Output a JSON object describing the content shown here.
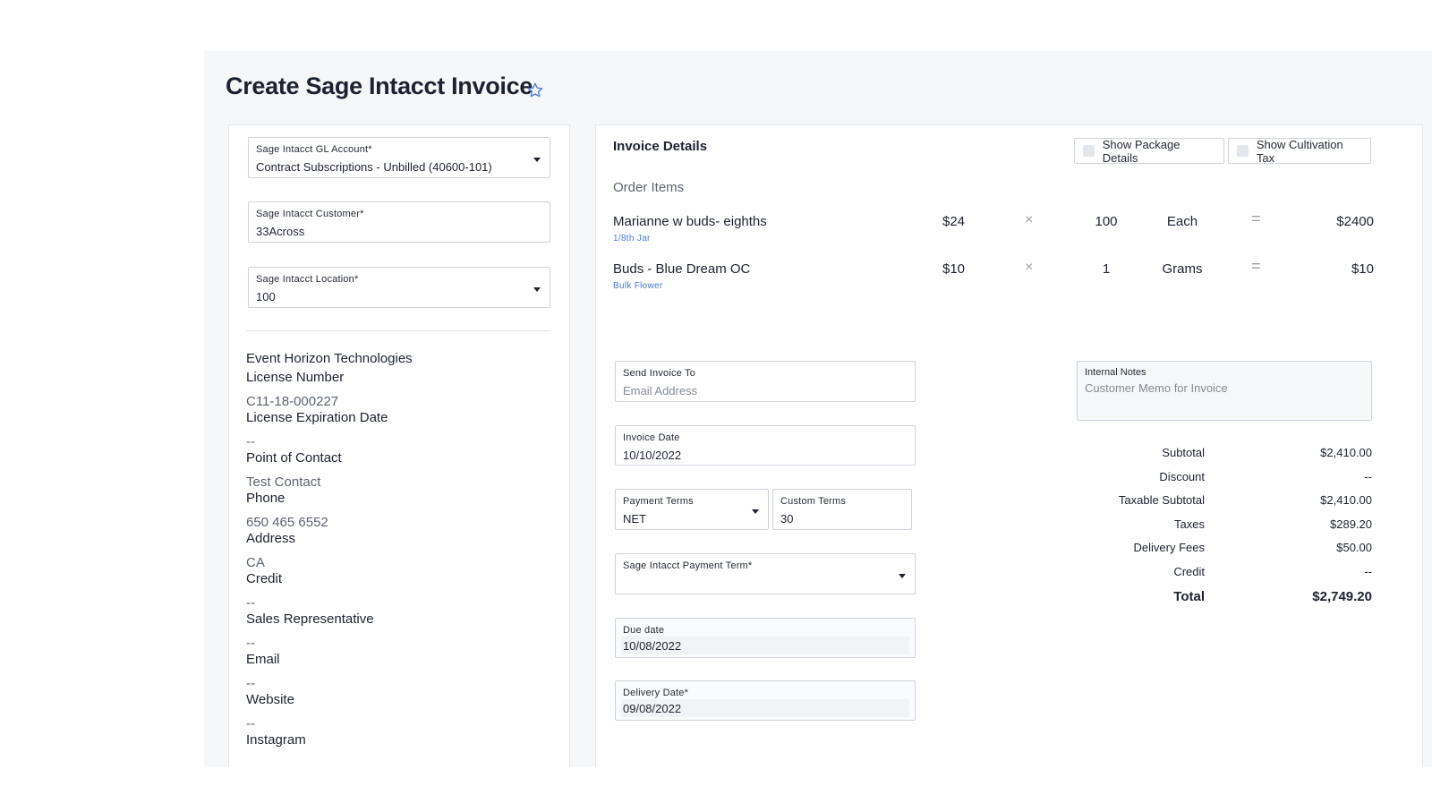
{
  "page": {
    "title": "Create Sage Intacct Invoice"
  },
  "left": {
    "gl_account": {
      "label": "Sage Intacct GL Account*",
      "value": "Contract Subscriptions - Unbilled (40600-101)"
    },
    "customer": {
      "label": "Sage Intacct Customer*",
      "value": "33Across"
    },
    "location": {
      "label": "Sage Intacct Location*",
      "value": "100"
    },
    "org_name": "Event Horizon Technologies",
    "details": [
      {
        "label": "License Number",
        "value": "C11-18-000227"
      },
      {
        "label": "License Expiration Date",
        "value": "--"
      },
      {
        "label": "Point of Contact",
        "value": "Test Contact"
      },
      {
        "label": "Phone",
        "value": "650 465 6552"
      },
      {
        "label": "Address",
        "value": "CA"
      },
      {
        "label": "Credit",
        "value": "--"
      },
      {
        "label": "Sales Representative",
        "value": "--"
      },
      {
        "label": "Email",
        "value": "--"
      },
      {
        "label": "Website",
        "value": "--"
      },
      {
        "label": "Instagram",
        "value": ""
      }
    ]
  },
  "right": {
    "title": "Invoice Details",
    "show_package_details": "Show Package Details",
    "show_cultivation_tax": "Show Cultivation Tax",
    "order_items_label": "Order Items",
    "items": [
      {
        "name": "Marianne w buds- eighths",
        "sub": "1/8th Jar",
        "price": "$24",
        "times": "×",
        "qty": "100",
        "unit": "Each",
        "equals": "=",
        "total": "$2400"
      },
      {
        "name": "Buds - Blue Dream OC",
        "sub": "Bulk Flower",
        "price": "$10",
        "times": "×",
        "qty": "1",
        "unit": "Grams",
        "equals": "=",
        "total": "$10"
      }
    ],
    "send_invoice_to": {
      "label": "Send Invoice To",
      "placeholder": "Email Address"
    },
    "invoice_date": {
      "label": "Invoice Date",
      "value": "10/10/2022"
    },
    "payment_terms": {
      "label": "Payment Terms",
      "value": "NET"
    },
    "custom_terms": {
      "label": "Custom Terms",
      "value": "30"
    },
    "sage_payment_term": {
      "label": "Sage Intacct Payment Term*",
      "value": ""
    },
    "due_date": {
      "label": "Due date",
      "value": "10/08/2022"
    },
    "delivery_date": {
      "label": "Delivery Date*",
      "value": "09/08/2022"
    },
    "internal_notes": {
      "label": "Internal Notes",
      "placeholder": "Customer Memo for Invoice"
    },
    "totals": {
      "subtotal": {
        "label": "Subtotal",
        "value": "$2,410.00"
      },
      "discount": {
        "label": "Discount",
        "value": "--"
      },
      "taxable_subtotal": {
        "label": "Taxable Subtotal",
        "value": "$2,410.00"
      },
      "taxes": {
        "label": "Taxes",
        "value": "$289.20"
      },
      "delivery_fees": {
        "label": "Delivery Fees",
        "value": "$50.00"
      },
      "credit": {
        "label": "Credit",
        "value": "--"
      },
      "total": {
        "label": "Total",
        "value": "$2,749.20"
      }
    }
  },
  "colors": {
    "accent": "#4a78d4",
    "border": "#cfd4db",
    "canvas": "#f6f7f9"
  },
  "icons": {
    "favorite": "star-outline-icon",
    "dropdown": "caret-down-icon"
  }
}
